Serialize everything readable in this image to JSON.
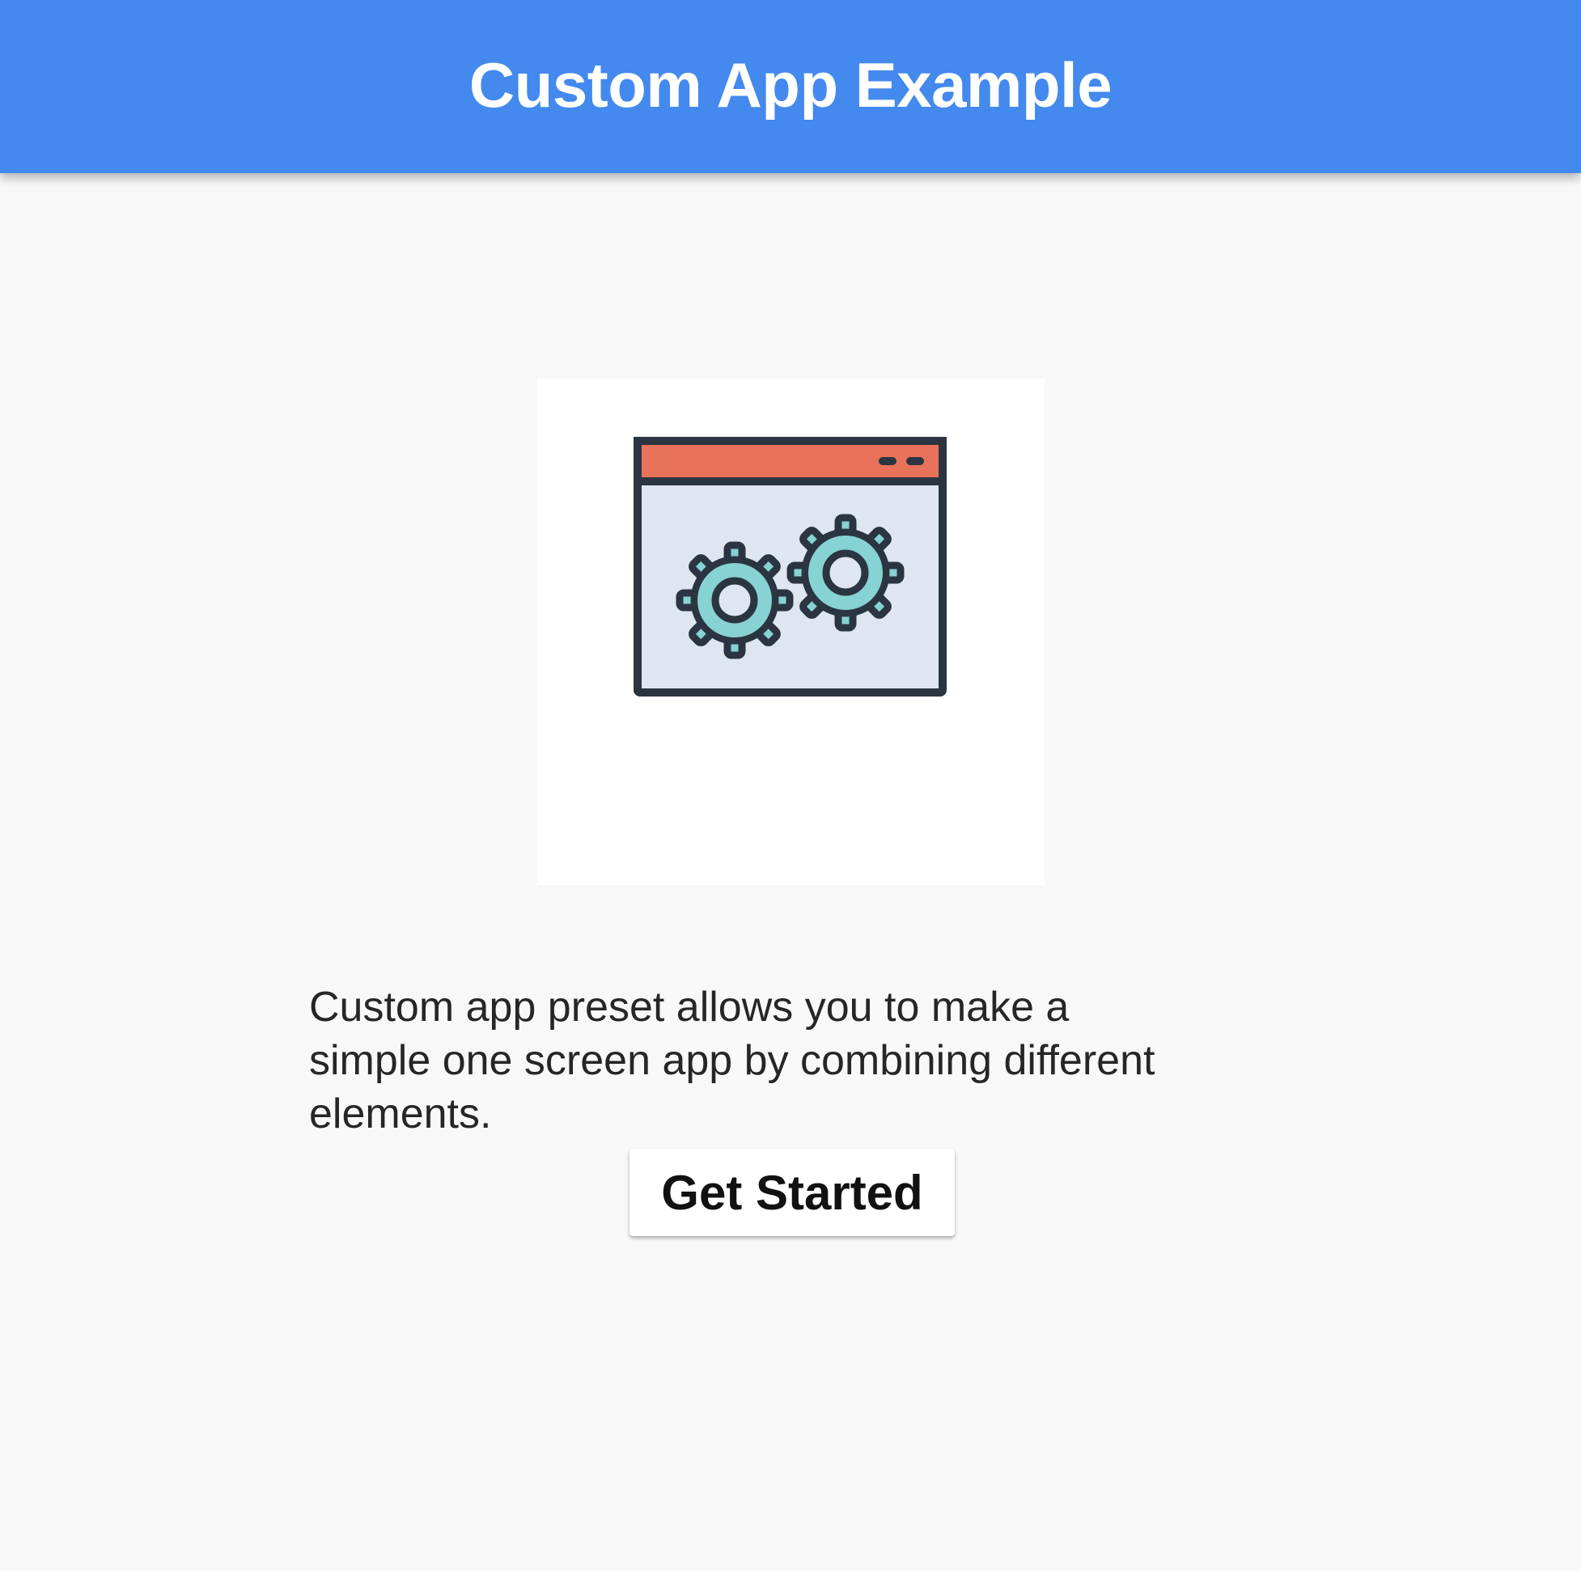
{
  "app_bar": {
    "title": "Custom App Example",
    "color": "#4389ee"
  },
  "hero": {
    "icon": "window-gears-icon",
    "colors": {
      "titlebar": "#e8725a",
      "window_fill": "#dfe6f1",
      "outline": "#2b3541",
      "gears": "#87d2d3"
    }
  },
  "body": {
    "description": "Custom app preset allows you to make a\nsimple one screen app by combining different\nelements."
  },
  "actions": {
    "primary_label": "Get Started"
  }
}
